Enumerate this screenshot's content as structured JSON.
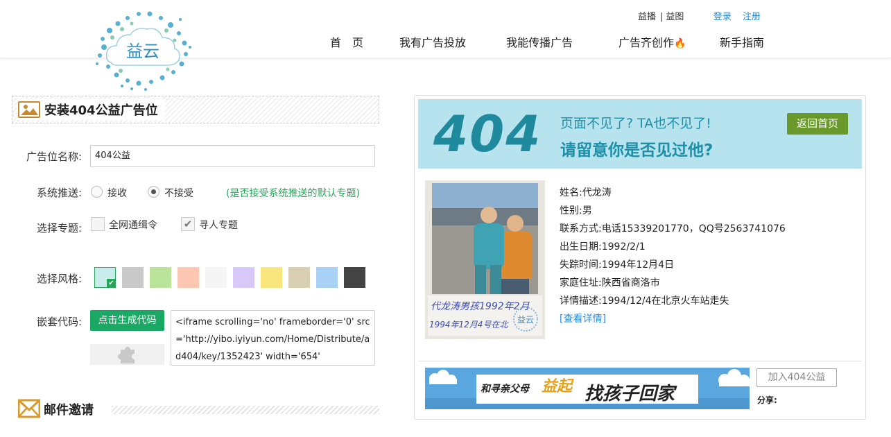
{
  "header": {
    "logo_text": "益云",
    "top_links": [
      "益播",
      "益图"
    ],
    "login": "登录",
    "register": "注册",
    "nav": [
      "首　页",
      "我有广告投放",
      "我能传播广告",
      "广告齐创作",
      "新手指南"
    ]
  },
  "form": {
    "section_title": "安装404公益广告位",
    "name_label": "广告位名称:",
    "name_value": "404公益",
    "push_label": "系统推送:",
    "push_options": [
      "接收",
      "不接受"
    ],
    "push_selected": "不接受",
    "push_hint": "(是否接受系统推送的默认专题)",
    "topic_label": "选择专题:",
    "topics": [
      {
        "label": "全网通缉令",
        "checked": false
      },
      {
        "label": "寻人专题",
        "checked": true
      }
    ],
    "style_label": "选择风格:",
    "styles": [
      "#c8ecec",
      "#c9c9c9",
      "#b9e49a",
      "#fcc6b3",
      "#f5f5f5",
      "#d7c8f8",
      "#f8e67c",
      "#d9d0b4",
      "#a9d0f5",
      "#444444"
    ],
    "selected_style": 0,
    "embed_label": "嵌套代码:",
    "generate_button": "点击生成代码",
    "embed_code": "<iframe scrolling='no' frameborder='0' src='http://yibo.iyiyun.com/Home/Distribute/ad404/key/1352423' width='654'",
    "mail_title": "邮件邀请"
  },
  "preview": {
    "big_text": "404",
    "line1": "页面不见了? TA也不见了!",
    "line2": "请留意你是否见过他?",
    "back_button": "返回首页",
    "photo_caption_1": "代龙涛男孩1992年2月",
    "photo_caption_2": "1994年12月4号在北",
    "person": [
      {
        "key": "姓名:",
        "value": "代龙涛"
      },
      {
        "key": "性别:",
        "value": "男"
      },
      {
        "key": "联系方式:",
        "value": "电话15339201770，QQ号2563741076"
      },
      {
        "key": "出生日期:",
        "value": "1992/2/1"
      },
      {
        "key": "失踪时间:",
        "value": "1994年12月4日"
      },
      {
        "key": "家庭住址:",
        "value": "陕西省商洛市"
      },
      {
        "key": "详情描述:",
        "value": "1994/12/4在北京火车站走失"
      }
    ],
    "more_link": "[查看详情]",
    "ad_text_1": "和寻亲父母",
    "ad_text_2": "益起",
    "ad_text_3": "找孩子回家",
    "join_button": "加入404公益",
    "share_label": "分享:"
  }
}
